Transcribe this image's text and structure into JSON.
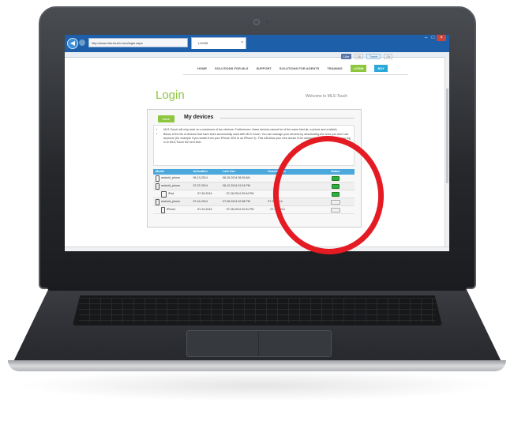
{
  "browser": {
    "address": "http://www.mls-touch.com/login.aspx",
    "tab_title": "LOGIN",
    "tab_close": "×"
  },
  "social": {
    "like": "Like",
    "like_count": "16",
    "tweet": "Tweet",
    "tweet_count": "29"
  },
  "nav": {
    "items": [
      "HOME",
      "SOLUTIONS FOR MLS",
      "SUPPORT",
      "SOLUTIONS FOR AGENTS",
      "TRAINING"
    ],
    "login": "LOGIN",
    "buy": "BUY"
  },
  "page": {
    "title": "Login",
    "welcome": "Welcome to MLS-Touch",
    "back": "Back",
    "section_title": "My devices"
  },
  "info": [
    "MLS-Touch will only work on a maximum of two devices. Furthermore, these devices cannot be of the same kind (ie. a phone and a tablet).",
    "Below is the list of devices that have been successfully used with MLS-Touch. You can manage your devices by deactivating the ones you don't use anymore (for example if you switch from your iPhone 3GS to an iPhone 4). This will allow your new device to be automatically activated when you log in to MLS-Touch the next time."
  ],
  "table": {
    "headers": [
      "Model",
      "Activation",
      "Last Use",
      "Deactivation",
      "Status"
    ],
    "rows": [
      {
        "model": "android_phone",
        "icon": "phone",
        "activation": "06-13-2014",
        "last_use": "08-15-2014 06:26 AM",
        "deactivation": "",
        "status": "on"
      },
      {
        "model": "android_phone",
        "icon": "phone",
        "activation": "07-22-2014",
        "last_use": "08-12-2014 01:24 PM",
        "deactivation": "",
        "status": "on"
      },
      {
        "model": "iPad",
        "icon": "ipad",
        "activation": "07-26-2014",
        "last_use": "07-26-2014 03:44 PM",
        "deactivation": "",
        "status": "on"
      },
      {
        "model": "android_phone",
        "icon": "phone",
        "activation": "07-24-2014",
        "last_use": "07-28-2014 02:38 PM",
        "deactivation": "07-24-2014",
        "status": "off"
      },
      {
        "model": "iPhone",
        "icon": "phone",
        "activation": "07-24-2014",
        "last_use": "07-28-2014 02:31 PM",
        "deactivation": "07-24-2014",
        "status": "off"
      }
    ]
  },
  "colors": {
    "accent_green": "#8dc63f",
    "header_blue": "#4aa8dc",
    "highlight_red": "#e41b23"
  }
}
